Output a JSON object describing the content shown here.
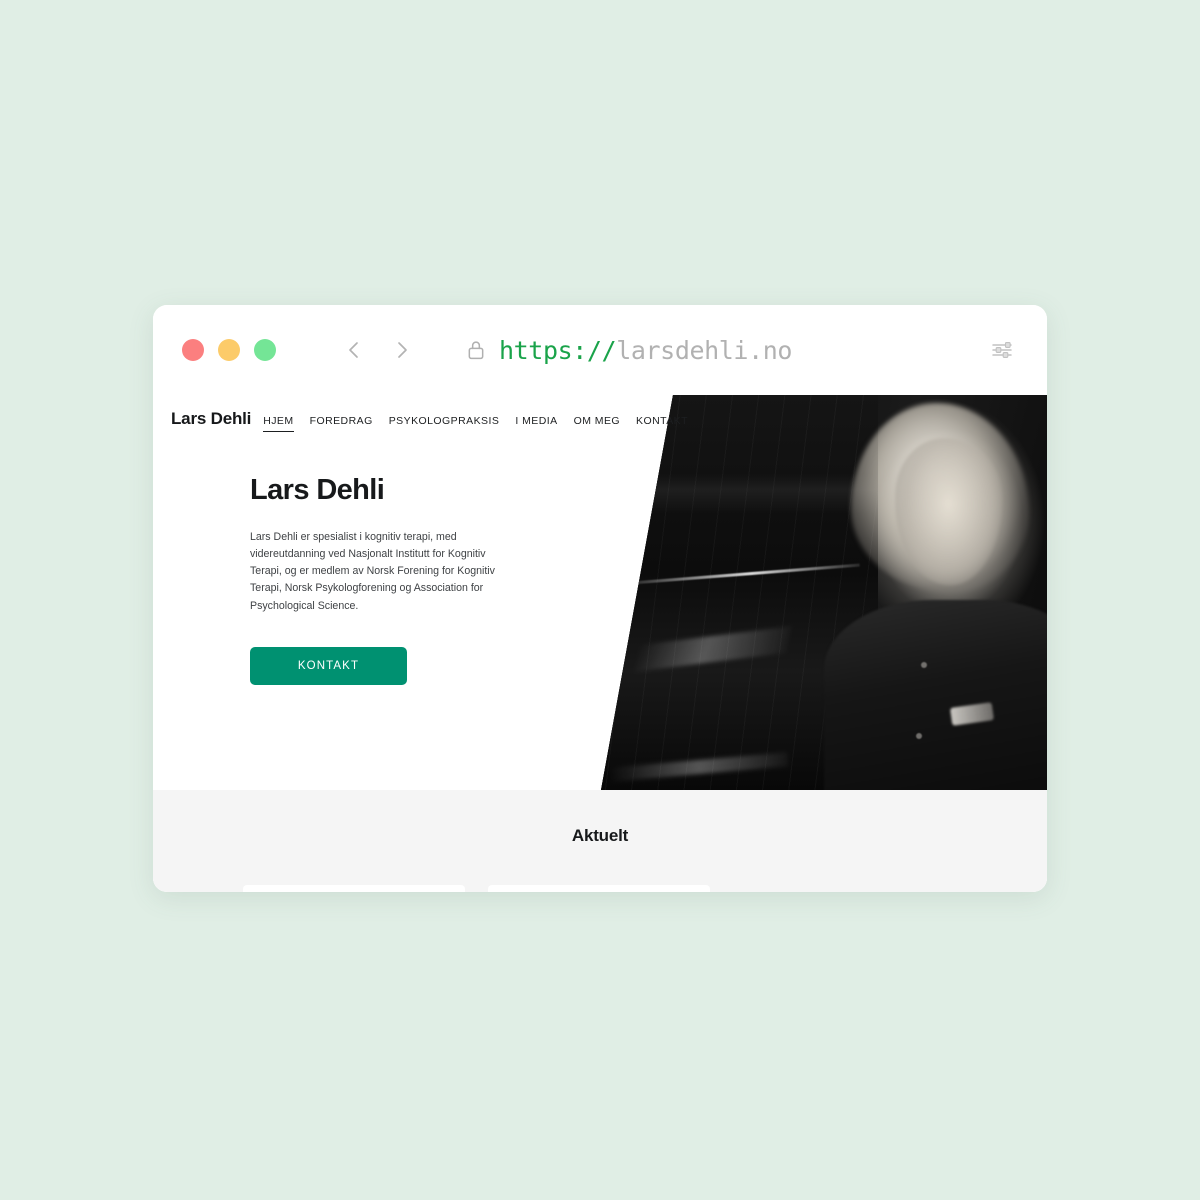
{
  "browser": {
    "traffic_lights": [
      {
        "name": "close",
        "color": "#fb7f7f"
      },
      {
        "name": "minimize",
        "color": "#fccb69"
      },
      {
        "name": "maximize",
        "color": "#74e596"
      }
    ],
    "back_label": "Back",
    "forward_label": "Forward",
    "lock_label": "Secure connection",
    "url_scheme": "https://",
    "url_host": "larsdehli.no",
    "url_full": "https://larsdehli.no",
    "settings_label": "Settings"
  },
  "site": {
    "logo": "Lars Dehli",
    "nav": [
      {
        "label": "HJEM",
        "active": true
      },
      {
        "label": "FOREDRAG",
        "active": false
      },
      {
        "label": "PSYKOLOGPRAKSIS",
        "active": false
      },
      {
        "label": "I MEDIA",
        "active": false
      },
      {
        "label": "OM MEG",
        "active": false
      },
      {
        "label": "KONTAKT",
        "active": false
      }
    ],
    "hero": {
      "title": "Lars Dehli",
      "body": "Lars Dehli er spesialist i kognitiv terapi, med videreutdanning ved Nasjonalt Institutt for Kognitiv Terapi, og er medlem av Norsk Forening for Kognitiv Terapi, Norsk Psykologforening og Association for Psychological Science.",
      "cta_label": "KONTAKT",
      "cta_color": "#009171",
      "photo_alt": "Portrait of Lars Dehli, black and white"
    },
    "aktuelt": {
      "title": "Aktuelt",
      "cards": [
        {
          "id": "card-1"
        },
        {
          "id": "card-2"
        }
      ]
    }
  },
  "theme": {
    "page_background": "#e0eee5",
    "window_background": "#ffffff",
    "section_background": "#f5f5f5",
    "accent": "#009171",
    "text_primary": "#17191b",
    "text_body": "#3f4245",
    "url_scheme_color": "#1aa34a",
    "url_host_color": "#b1b1b1"
  }
}
